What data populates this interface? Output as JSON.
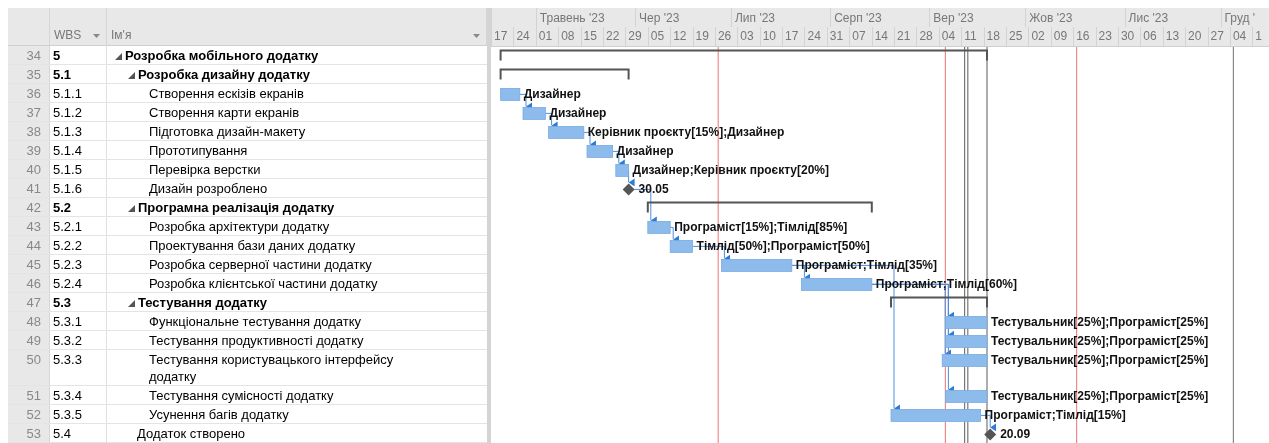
{
  "table": {
    "columns": [
      {
        "label": "WBS",
        "sortable": true
      },
      {
        "label": "Ім'я",
        "sortable": true
      }
    ]
  },
  "timeline": {
    "months": [
      "Травень '23",
      "Чер '23",
      "Лип '23",
      "Серп '23",
      "Вер '23",
      "Жов '23",
      "Лис '23",
      "Груд '"
    ],
    "weeks": [
      "17",
      "24",
      "01",
      "08",
      "15",
      "22",
      "29",
      "05",
      "12",
      "19",
      "26",
      "03",
      "10",
      "17",
      "24",
      "31",
      "07",
      "14",
      "21",
      "28",
      "04",
      "11",
      "18",
      "25",
      "02",
      "09",
      "16",
      "23",
      "30",
      "06",
      "13",
      "20",
      "27",
      "04",
      "1"
    ]
  },
  "rows": [
    {
      "id": "34",
      "wbs": "5",
      "name": "Розробка мобільного додатку",
      "kind": "summary",
      "expanded": true,
      "children": [
        {
          "id": "35",
          "wbs": "5.1",
          "name": "Розробка дизайну додатку",
          "kind": "summary",
          "expanded": true,
          "children": [
            {
              "id": "36",
              "wbs": "5.1.1",
              "name": "Створення ескізів екранів",
              "kind": "task",
              "label": "Дизайнер"
            },
            {
              "id": "37",
              "wbs": "5.1.2",
              "name": "Створення карти екранів",
              "kind": "task",
              "label": "Дизайнер"
            },
            {
              "id": "38",
              "wbs": "5.1.3",
              "name": "Підготовка дизайн-макету",
              "kind": "task",
              "label": "Керівник проєкту[15%];Дизайнер"
            },
            {
              "id": "39",
              "wbs": "5.1.4",
              "name": "Прототипування",
              "kind": "task",
              "label": "Дизайнер"
            },
            {
              "id": "40",
              "wbs": "5.1.5",
              "name": "Перевірка верстки",
              "kind": "task",
              "label": "Дизайнер;Керівник проєкту[20%]"
            },
            {
              "id": "41",
              "wbs": "5.1.6",
              "name": "Дизайн розроблено",
              "kind": "milestone",
              "label": "30.05"
            }
          ]
        },
        {
          "id": "42",
          "wbs": "5.2",
          "name": "Програмна реалізація додатку",
          "kind": "summary",
          "expanded": true,
          "children": [
            {
              "id": "43",
              "wbs": "5.2.1",
              "name": "Розробка архітектури додатку",
              "kind": "task",
              "label": "Програміст[15%];Тімлід[85%]"
            },
            {
              "id": "44",
              "wbs": "5.2.2",
              "name": "Проектування бази даних додатку",
              "kind": "task",
              "label": "Тімлід[50%];Програміст[50%]"
            },
            {
              "id": "45",
              "wbs": "5.2.3",
              "name": "Розробка серверної частини додатку",
              "kind": "task",
              "label": "Програміст;Тімлід[35%]"
            },
            {
              "id": "46",
              "wbs": "5.2.4",
              "name": "Розробка клієнтської частини додатку",
              "kind": "task",
              "label": "Програміст;Тімлід[60%]"
            }
          ]
        },
        {
          "id": "47",
          "wbs": "5.3",
          "name": "Тестування додатку",
          "kind": "summary",
          "expanded": true,
          "children": [
            {
              "id": "48",
              "wbs": "5.3.1",
              "name": "Функціональне тестування додатку",
              "kind": "task",
              "label": "Тестувальник[25%];Програміст[25%]"
            },
            {
              "id": "49",
              "wbs": "5.3.2",
              "name": "Тестування продуктивності додатку",
              "kind": "task",
              "label": "Тестувальник[25%];Програміст[25%]"
            },
            {
              "id": "50",
              "wbs": "5.3.3",
              "name": "Тестування користувацького інтерфейсу додатку",
              "kind": "task",
              "label": "Тестувальник[25%];Програміст[25%]"
            },
            {
              "id": "51",
              "wbs": "5.3.4",
              "name": "Тестування сумісності додатку",
              "kind": "task",
              "label": "Тестувальник[25%];Програміст[25%]"
            },
            {
              "id": "52",
              "wbs": "5.3.5",
              "name": "Усунення багів додатку",
              "kind": "task",
              "label": "Програміст;Тімлід[15%]"
            }
          ]
        },
        {
          "id": "53",
          "wbs": "5.4",
          "name": "Додаток створено",
          "kind": "milestone",
          "label": "20.09"
        }
      ]
    }
  ]
}
